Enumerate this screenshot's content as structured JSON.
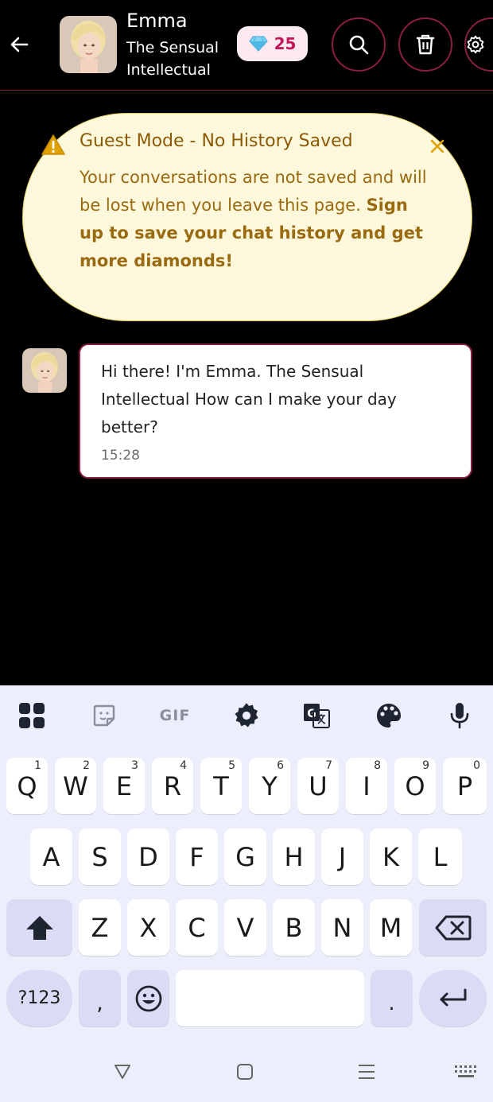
{
  "header": {
    "name": "Emma",
    "subtitle": "The Sensual Intellectual",
    "diamonds": "25",
    "icons": [
      "back-arrow-icon",
      "diamond-icon",
      "search-icon",
      "trash-icon",
      "settings-icon"
    ]
  },
  "banner": {
    "title": "Guest Mode - No History Saved",
    "body_plain": "Your conversations are not saved and will be lost when you leave this page. ",
    "body_bold": "Sign up to save your chat history and get more diamonds!"
  },
  "chat": {
    "messages": [
      {
        "text": "Hi there! I'm Emma. The Sensual Intellectual How can I make your day better?",
        "time": "15:28"
      }
    ]
  },
  "keyboard": {
    "row1": [
      {
        "label": "Q",
        "hint": "1"
      },
      {
        "label": "W",
        "hint": "2"
      },
      {
        "label": "E",
        "hint": "3"
      },
      {
        "label": "R",
        "hint": "4"
      },
      {
        "label": "T",
        "hint": "5"
      },
      {
        "label": "Y",
        "hint": "6"
      },
      {
        "label": "U",
        "hint": "7"
      },
      {
        "label": "I",
        "hint": "8"
      },
      {
        "label": "O",
        "hint": "9"
      },
      {
        "label": "P",
        "hint": "0"
      }
    ],
    "row2": [
      "A",
      "S",
      "D",
      "F",
      "G",
      "H",
      "J",
      "K",
      "L"
    ],
    "row3": [
      "Z",
      "X",
      "C",
      "V",
      "B",
      "N",
      "M"
    ],
    "sym_label": "?123",
    "comma": ",",
    "period": ".",
    "gif_label": "GIF"
  },
  "colors": {
    "accent": "#c2185b",
    "border_accent": "#8a1e3e",
    "banner_bg": "#fdf8dc",
    "banner_text": "#9a6a10",
    "keyboard_bg": "#eceffb"
  }
}
